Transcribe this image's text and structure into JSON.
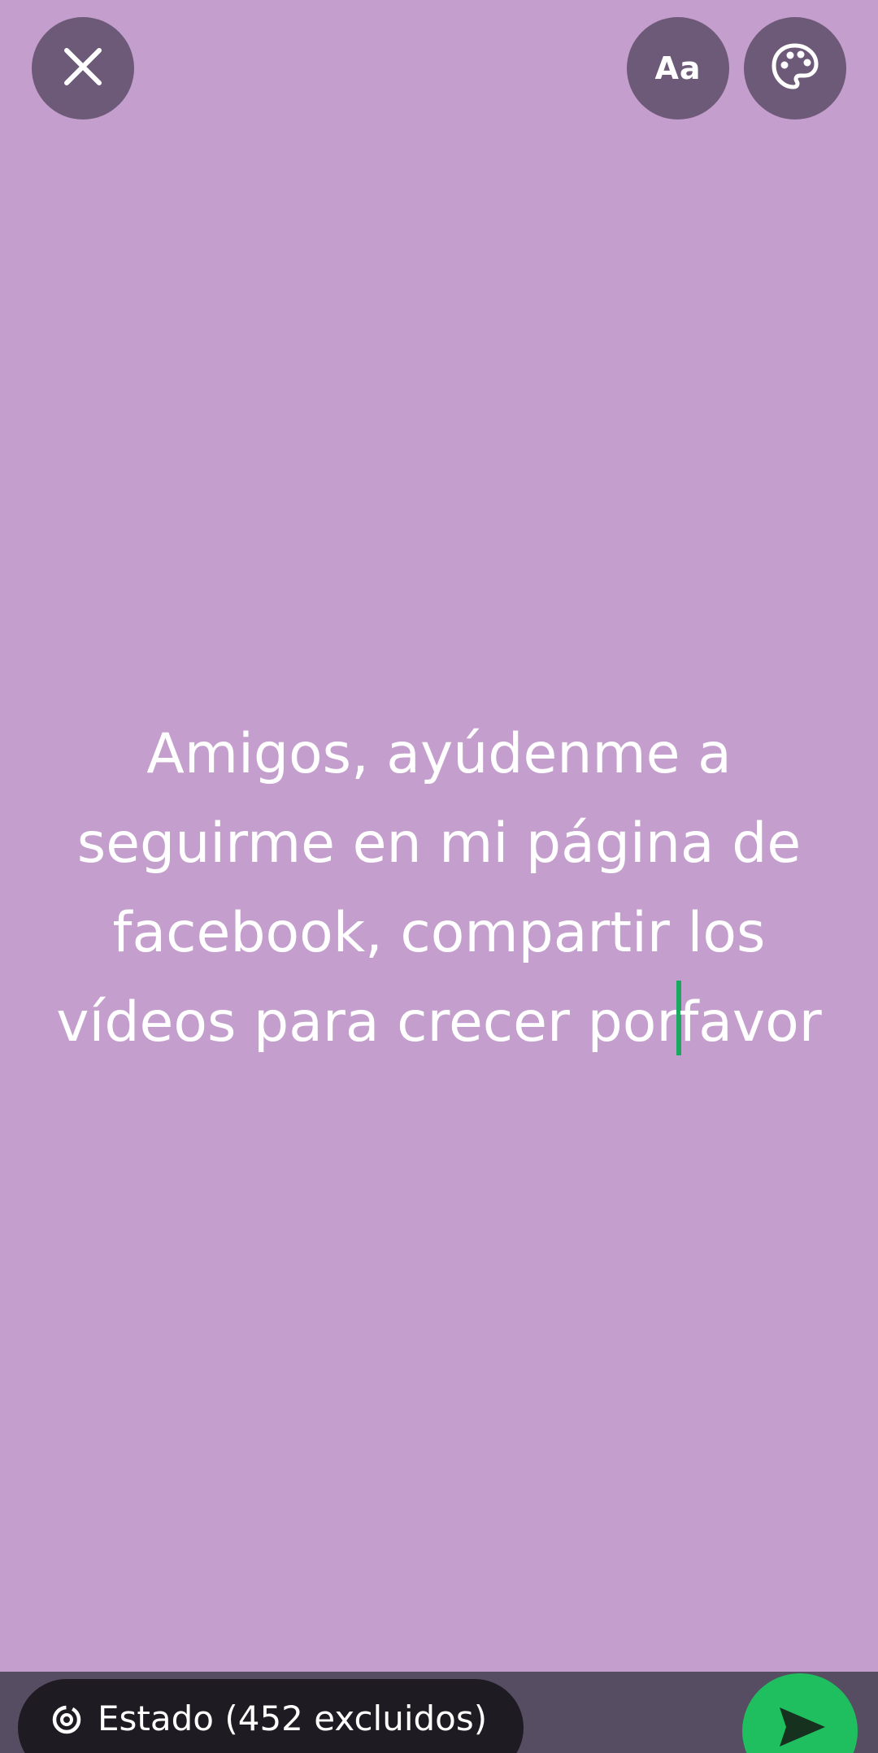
{
  "status_text": {
    "before_caret": "Amigos, ayúdenme a seguirme en mi página de facebook, compartir los vídeos para crecer por",
    "after_caret": "favor"
  },
  "toolbar": {
    "close_icon": "close-icon",
    "font_button_label": "Aa",
    "palette_icon": "palette-icon"
  },
  "bottom": {
    "audience_label": "Estado (452 excluidos)",
    "audience_icon": "status-ring-icon",
    "send_icon": "send-icon"
  },
  "colors": {
    "background": "#c49ecc",
    "button_background": "#6d5a78",
    "caret": "#1aa860",
    "send_button": "#1fbf5f",
    "bottom_bar": "#574d63"
  }
}
